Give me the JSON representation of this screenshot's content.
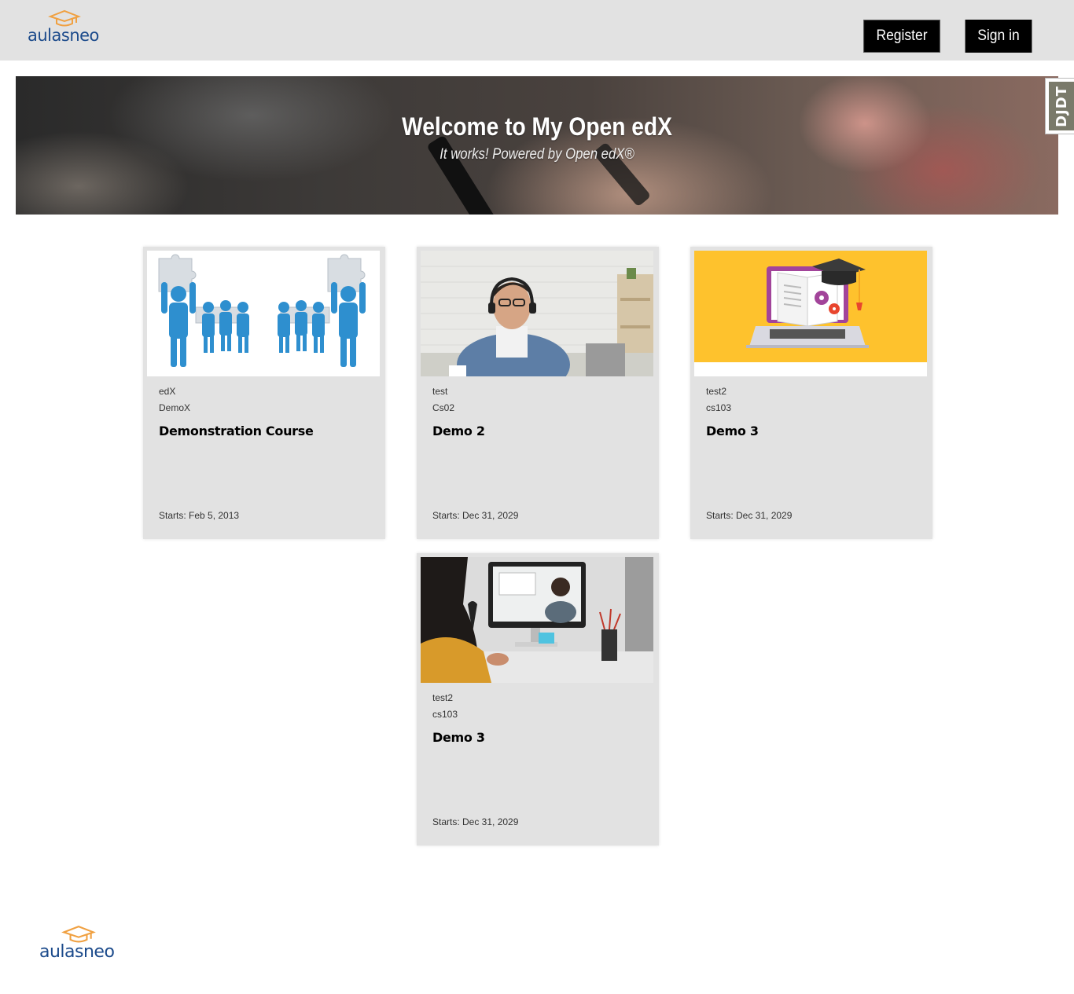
{
  "header": {
    "logo_text": "aulasneo",
    "register_label": "Register",
    "signin_label": "Sign in"
  },
  "hero": {
    "title": "Welcome to My Open edX",
    "subtitle": "It works! Powered by Open edX®"
  },
  "djdt": {
    "label": "DJDT"
  },
  "courses": [
    {
      "org": "edX",
      "code": "DemoX",
      "title": "Demonstration Course",
      "starts": "Starts: Feb 5, 2013",
      "image": "puzzle-team-illustration"
    },
    {
      "org": "test",
      "code": "Cs02",
      "title": "Demo 2",
      "starts": "Starts: Dec 31, 2029",
      "image": "student-with-headphones-photo"
    },
    {
      "org": "test2",
      "code": "cs103",
      "title": "Demo 3",
      "starts": "Starts: Dec 31, 2029",
      "image": "laptop-book-graduation-cap-illustration"
    },
    {
      "org": "test2",
      "code": "cs103",
      "title": "Demo 3",
      "starts": "Starts: Dec 31, 2029",
      "image": "online-class-computer-photo"
    }
  ],
  "footer": {
    "logo_text": "aulasneo"
  },
  "colors": {
    "header_bg": "#e2e2e2",
    "card_bg": "#e2e2e2",
    "logo_blue": "#1b4a8b",
    "logo_orange": "#f0a040",
    "button_bg": "#000000"
  }
}
